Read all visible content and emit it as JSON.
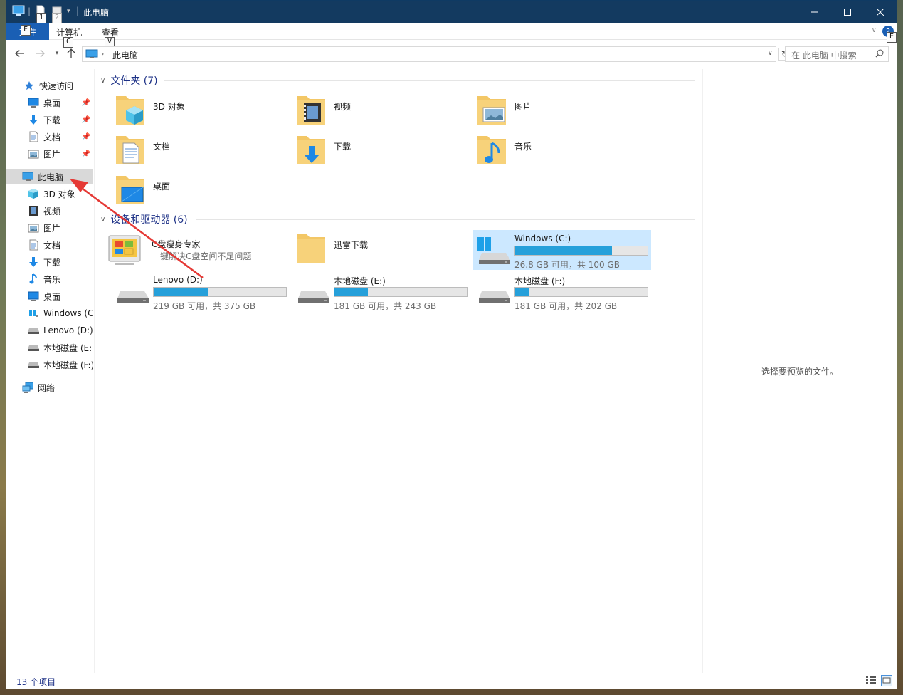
{
  "window": {
    "title": "此电脑"
  },
  "quick_access_toolbar": {
    "keytip_1": "1",
    "keytip_2": "2"
  },
  "ribbon": {
    "file_tab": "文件",
    "file_keytip": "F",
    "tabs": [
      {
        "label": "计算机",
        "keytip": "C"
      },
      {
        "label": "查看",
        "keytip": "V"
      }
    ],
    "help_keytip": "E"
  },
  "address": {
    "path": "此电脑",
    "search_placeholder": "在 此电脑 中搜索"
  },
  "nav": {
    "quick_access": "快速访问",
    "quick_items": [
      {
        "label": "桌面",
        "icon": "desktop-icon"
      },
      {
        "label": "下载",
        "icon": "download-icon"
      },
      {
        "label": "文档",
        "icon": "document-icon"
      },
      {
        "label": "图片",
        "icon": "picture-icon"
      }
    ],
    "this_pc": "此电脑",
    "pc_items": [
      {
        "label": "3D 对象",
        "icon": "cube-icon"
      },
      {
        "label": "视频",
        "icon": "video-icon"
      },
      {
        "label": "图片",
        "icon": "picture-icon"
      },
      {
        "label": "文档",
        "icon": "document-icon"
      },
      {
        "label": "下载",
        "icon": "download-icon"
      },
      {
        "label": "音乐",
        "icon": "music-icon"
      },
      {
        "label": "桌面",
        "icon": "desktop-icon"
      },
      {
        "label": "Windows (C",
        "icon": "windows-drive-icon"
      },
      {
        "label": "Lenovo (D:)",
        "icon": "drive-icon"
      },
      {
        "label": "本地磁盘 (E:)",
        "icon": "drive-icon"
      },
      {
        "label": "本地磁盘 (F:)",
        "icon": "drive-icon"
      }
    ],
    "network": "网络"
  },
  "folders": {
    "header": "文件夹 (7)",
    "items": [
      {
        "label": "3D 对象",
        "icon": "cube-folder-icon"
      },
      {
        "label": "视频",
        "icon": "video-folder-icon"
      },
      {
        "label": "图片",
        "icon": "picture-folder-icon"
      },
      {
        "label": "文档",
        "icon": "document-folder-icon"
      },
      {
        "label": "下载",
        "icon": "download-folder-icon"
      },
      {
        "label": "音乐",
        "icon": "music-folder-icon"
      },
      {
        "label": "桌面",
        "icon": "desktop-folder-icon"
      }
    ]
  },
  "devices": {
    "header": "设备和驱动器 (6)",
    "app": {
      "name": "C盘瘦身专家",
      "desc": "一键解决C盘空间不足问题"
    },
    "thunder": {
      "name": "迅雷下载"
    },
    "drives": [
      {
        "name": "Windows (C:)",
        "free": "26.8 GB 可用，共 100 GB",
        "used_fraction": 0.732,
        "selected": true
      },
      {
        "name": "Lenovo (D:)",
        "free": "219 GB 可用，共 375 GB",
        "used_fraction": 0.416
      },
      {
        "name": "本地磁盘 (E:)",
        "free": "181 GB 可用，共 243 GB",
        "used_fraction": 0.255
      },
      {
        "name": "本地磁盘 (F:)",
        "free": "181 GB 可用，共 202 GB",
        "used_fraction": 0.104
      }
    ]
  },
  "preview": {
    "message": "选择要预览的文件。"
  },
  "status": {
    "count": "13 个项目"
  },
  "colors": {
    "accent": "#1a5fb4",
    "titlebar": "#133a60",
    "drive_fill": "#26a0da",
    "annotation_arrow": "#e53935"
  }
}
